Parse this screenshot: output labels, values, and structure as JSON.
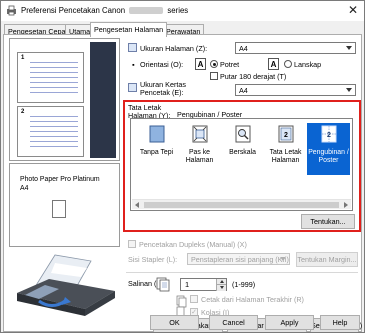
{
  "window": {
    "title_prefix": "Preferensi Pencetakan Canon",
    "title_suffix": "series",
    "close_glyph": "✕"
  },
  "tabs": [
    {
      "label": "Pengesetan Cepat"
    },
    {
      "label": "Utama"
    },
    {
      "label": "Pengesetan Halaman"
    },
    {
      "label": "Perawatan"
    }
  ],
  "left": {
    "preview_pages": [
      "1",
      "2"
    ],
    "media_name": "Photo Paper Pro Platinum",
    "media_size": "A4"
  },
  "page_size": {
    "label": "Ukuran Halaman (Z):",
    "value": "A4"
  },
  "orientation": {
    "label": "Orientasi (O):",
    "portrait_glyph": "A",
    "portrait_label": "Potret",
    "landscape_glyph": "A",
    "landscape_label": "Lanskap",
    "rotate_label": "Putar 180 derajat (T)"
  },
  "printer_paper_size": {
    "label_line1": "Ukuran Kertas",
    "label_line2": "Pencetak (E):",
    "value": "A4"
  },
  "layout": {
    "label_line1": "Tata Letak",
    "label_line2": "Halaman (Y):",
    "current": "Pengubinan / Poster",
    "items": [
      {
        "label1": "Tanpa Tepi",
        "label2": ""
      },
      {
        "label1": "Pas ke",
        "label2": "Halaman"
      },
      {
        "label1": "Berskala",
        "label2": ""
      },
      {
        "label1": "Tata Letak",
        "label2": "Halaman"
      },
      {
        "label1": "Pengubinan /",
        "label2": "Poster"
      }
    ],
    "selected_index": 4,
    "specify_button": "Tentukan..."
  },
  "duplex": {
    "checkbox_label": "Pencetakan Dupleks (Manual) (X)",
    "staple_label": "Sisi Stapler (L):",
    "staple_value": "Penstapleran sisi panjang (Kri)",
    "margin_button": "Tentukan Margin..."
  },
  "copies": {
    "label": "Salinan (C):",
    "value": "1",
    "range": "(1-999)",
    "last_page_first": "Cetak dari Halaman Terakhir (R)",
    "collate": "Kolasi (I)"
  },
  "bottom_buttons": {
    "print_options": "Opsi Pencetakan...",
    "stamp_background": "Cap/Latar Belakang...",
    "defaults": "Setelan Asal (F)"
  },
  "dialog_buttons": {
    "ok": "OK",
    "cancel": "Cancel",
    "apply": "Apply",
    "help": "Help"
  },
  "colors": {
    "highlight_red": "#e0201c",
    "selection_blue": "#0a64d2"
  }
}
